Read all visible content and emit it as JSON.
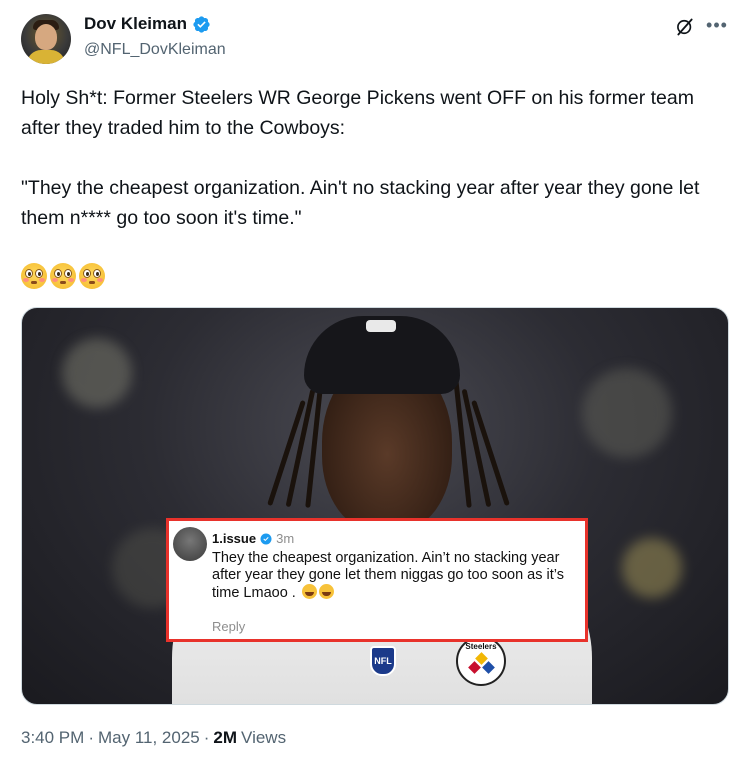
{
  "author": {
    "display_name": "Dov Kleiman",
    "handle": "@NFL_DovKleiman",
    "verified": true
  },
  "tweet": {
    "text": "Holy Sh*t: Former Steelers WR George Pickens went OFF on his former team after they traded him to the Cowboys:\n\n\"They the cheapest organization. Ain't no stacking year after year they gone let them n**** go too soon it's time.\"",
    "emojis": [
      "flushed-face",
      "flushed-face",
      "flushed-face"
    ]
  },
  "media": {
    "comment": {
      "username": "1.issue",
      "time": "3m",
      "text": "They the cheapest organization. Ain’t no stacking year after year they gone let them niggas go too soon as it’s time Lmaoo .",
      "reaction_emojis": [
        "face-with-tears-of-joy",
        "face-with-tears-of-joy"
      ],
      "reply_label": "Reply"
    },
    "jersey_marks": {
      "nfl": "NFL",
      "team": "Steelers"
    }
  },
  "meta": {
    "time": "3:40 PM",
    "separator": "·",
    "date": "May 11, 2025",
    "views_count": "2M",
    "views_label": "Views"
  },
  "colors": {
    "verified_blue": "#1d9bf0",
    "text_primary": "#0f1419",
    "text_secondary": "#536471",
    "highlight_red": "#e8322b"
  },
  "icons": {
    "grok": "grok-icon",
    "more": "more-icon"
  }
}
